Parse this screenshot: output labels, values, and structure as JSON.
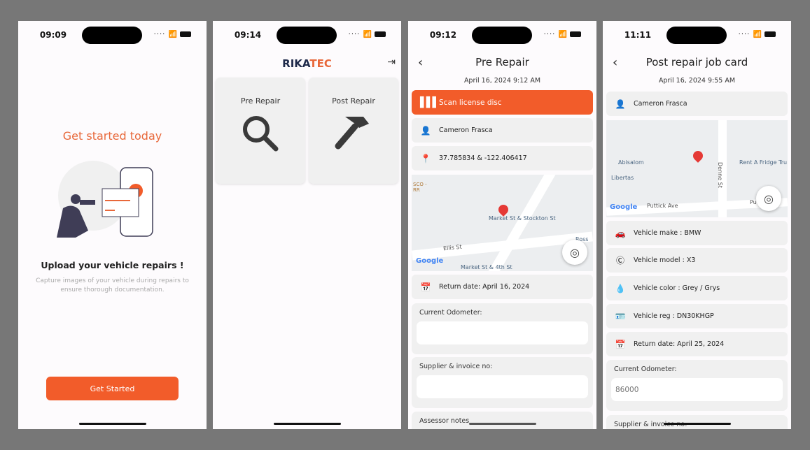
{
  "screens": [
    {
      "status_time": "09:09",
      "title": "Get started today",
      "heading": "Upload your vehicle repairs !",
      "subtitle": "Capture images of your vehicle during repairs to ensure thorough documentation.",
      "button": "Get Started"
    },
    {
      "status_time": "09:14",
      "logo_part1": "RIKA",
      "logo_part2": "TEC",
      "logo_text": "RIKATEC",
      "cards": [
        {
          "label": "Pre Repair",
          "icon": "search-icon"
        },
        {
          "label": "Post Repair",
          "icon": "hammer-icon"
        }
      ]
    },
    {
      "status_time": "09:12",
      "title": "Pre Repair",
      "date": "April 16, 2024 9:12 AM",
      "scan_button": "Scan license disc",
      "name": "Cameron Frasca",
      "coords": "37.785834 & -122.406417",
      "map_labels": [
        "Market St & Stockton St",
        "Ellis St",
        "Market St & 4th St",
        "SCO - RR",
        "Ross D"
      ],
      "return_date": "Return date: April 16, 2024",
      "odometer_label": "Current Odometer:",
      "odometer_value": "",
      "supplier_label": "Supplier & invoice no:",
      "supplier_value": "",
      "notes_label": "Assessor notes"
    },
    {
      "status_time": "11:11",
      "title": "Post repair job card",
      "date": "April 16, 2024 9:55 AM",
      "name": "Cameron Frasca",
      "map_labels": [
        "Abisalom",
        "Libertas",
        "Denne St",
        "Rent A Fridge Tru",
        "Puttick Ave",
        "Pu"
      ],
      "vehicle_make": "Vehicle make : BMW",
      "vehicle_model": "Vehicle model : X3",
      "vehicle_color": "Vehicle color : Grey / Grys",
      "vehicle_reg": "Vehicle reg : DN30KHGP",
      "return_date": "Return date: April 25, 2024",
      "odometer_label": "Current Odometer:",
      "odometer_placeholder": "86000",
      "supplier_label": "Supplier & invoice no:"
    }
  ],
  "map_attribution": "Google",
  "colors": {
    "accent": "#f25c2a",
    "title_orange": "#e8683a",
    "card_bg": "#f0f0f0",
    "logo_dark": "#1f2a4a"
  }
}
